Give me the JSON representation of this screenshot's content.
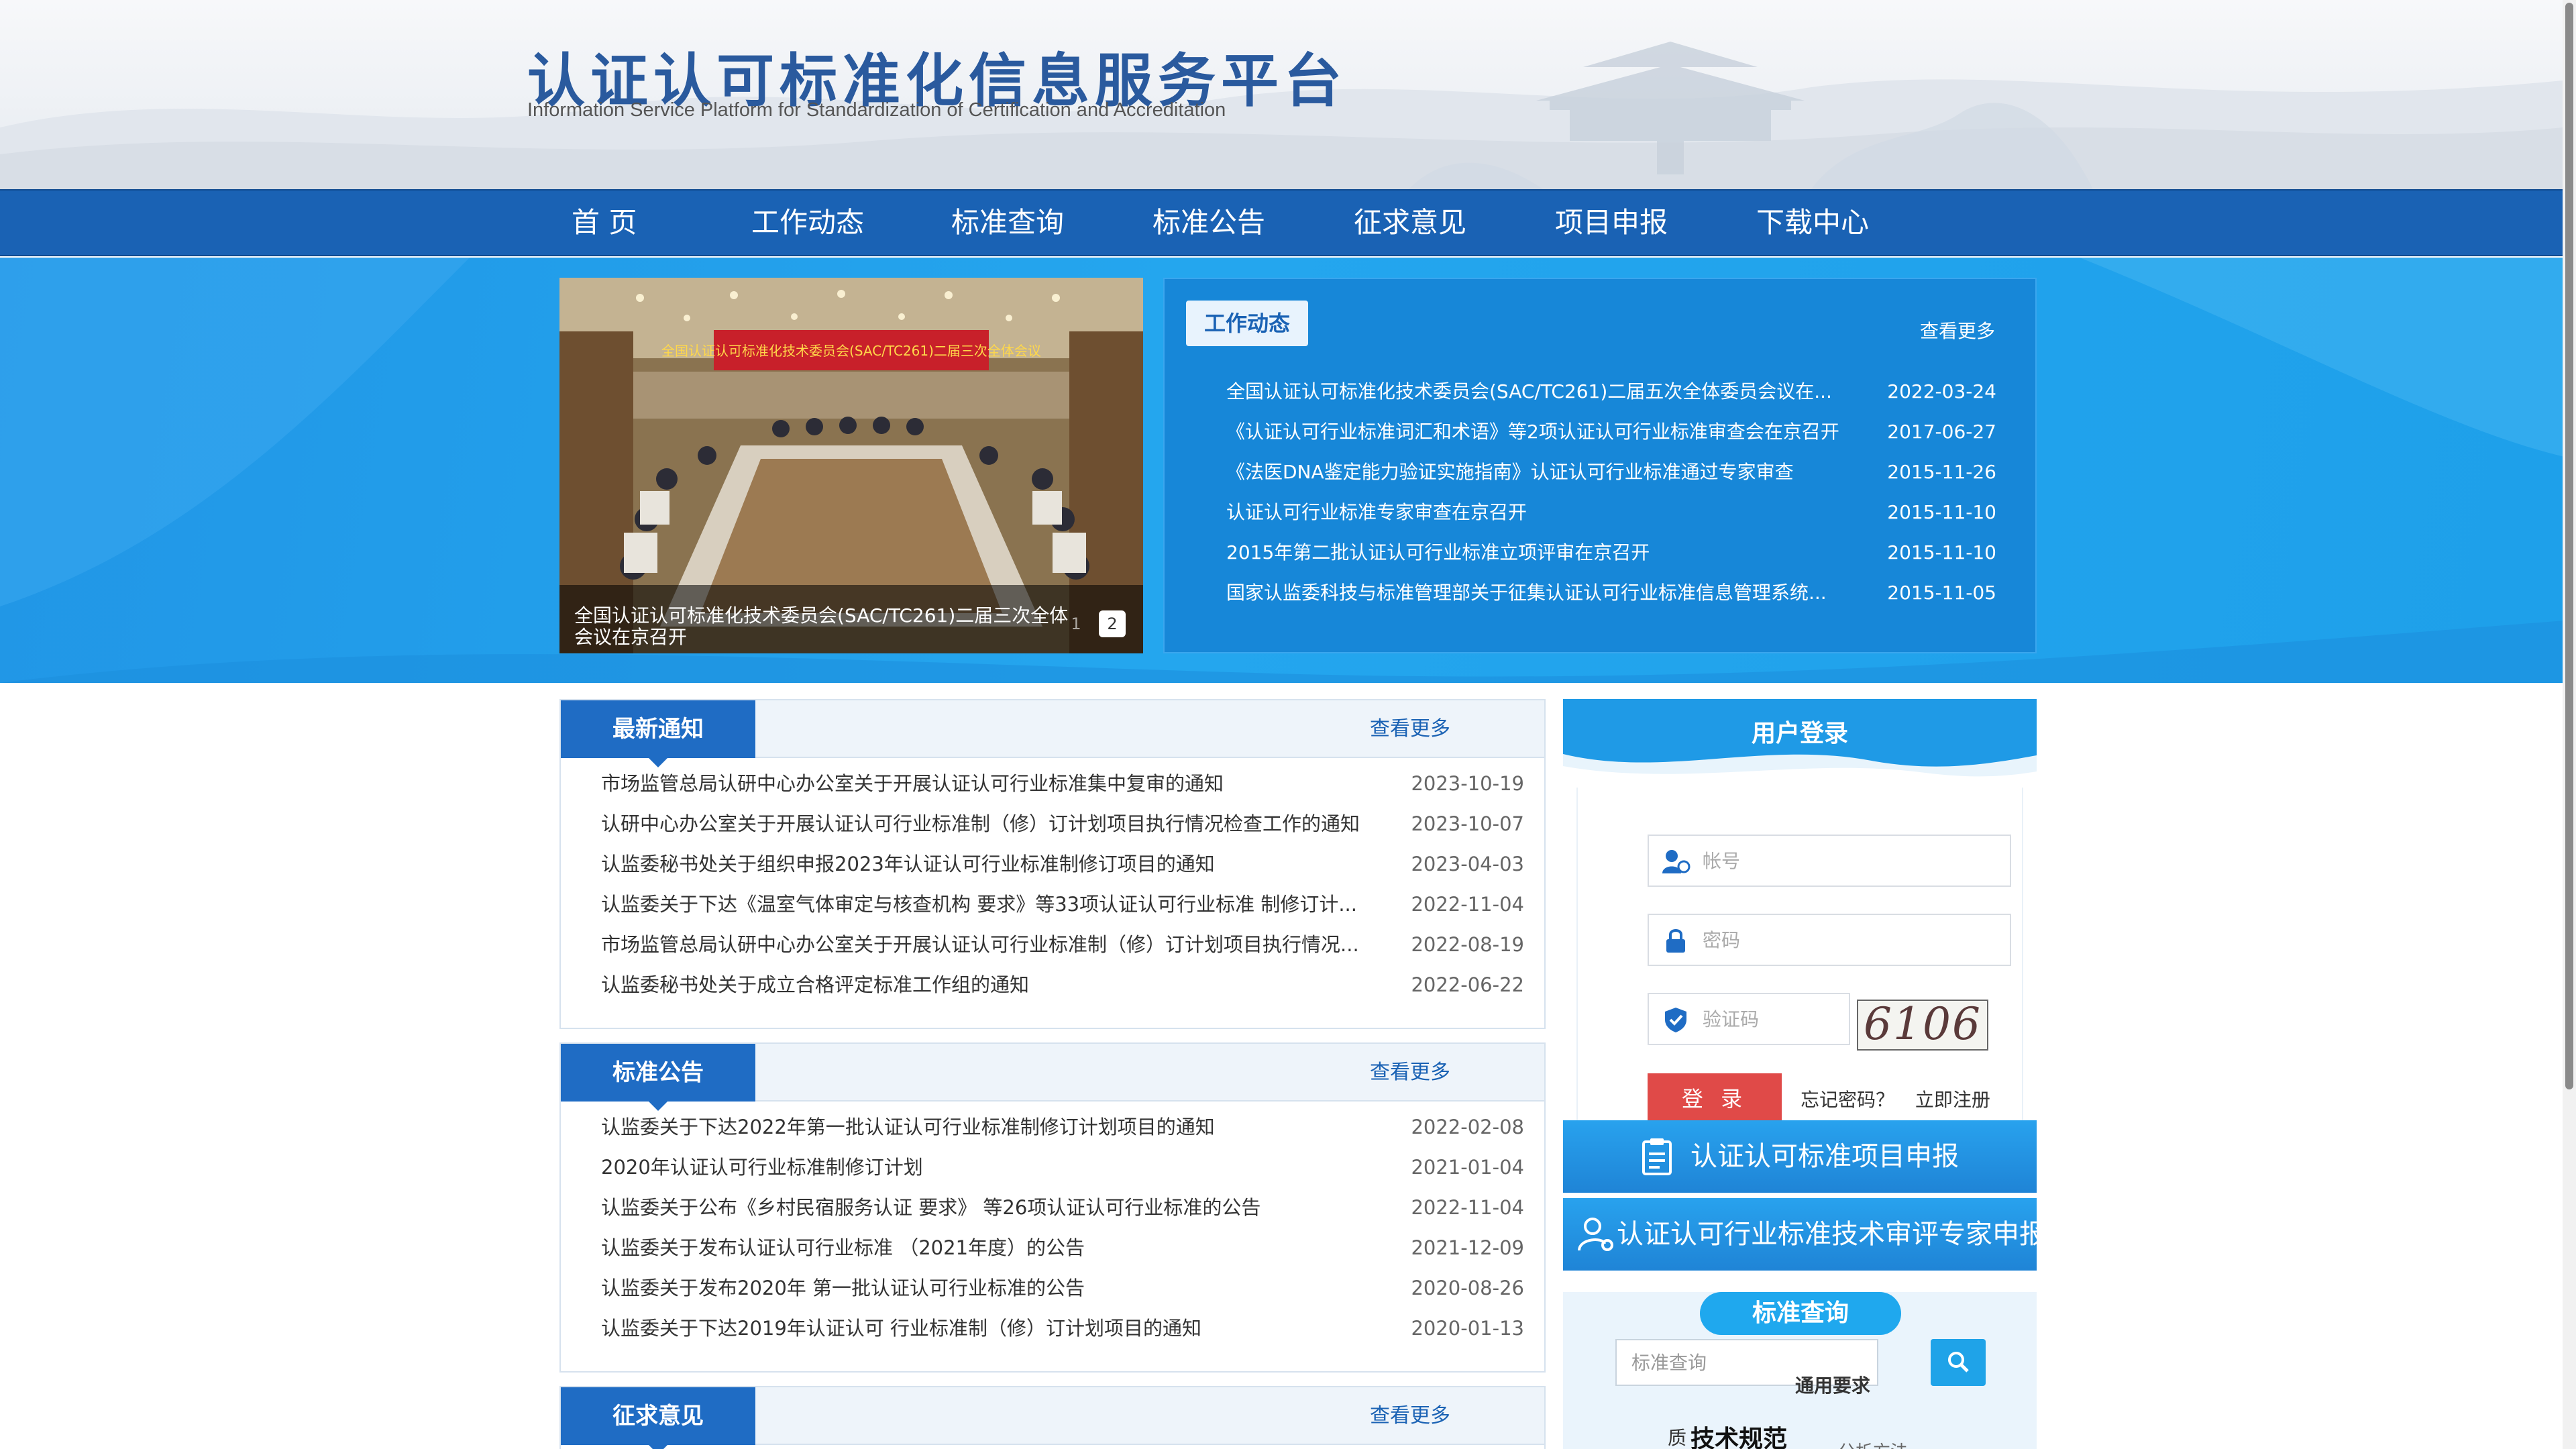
{
  "header": {
    "title": "认证认可标准化信息服务平台",
    "subtitle": "Information Service Platform for Standardization of Certification and Accreditation"
  },
  "nav": {
    "items": [
      "首 页",
      "工作动态",
      "标准查询",
      "标准公告",
      "征求意见",
      "项目申报",
      "下载中心"
    ]
  },
  "slideshow": {
    "banner_text": "全国认证认可标准化技术委员会(SAC/TC261)二届三次全体会议",
    "caption": "全国认证认可标准化技术委员会(SAC/TC261)二届三次全体会议在京召开",
    "dot1": "1",
    "dot2": "2"
  },
  "work": {
    "tab": "工作动态",
    "more": "查看更多",
    "items": [
      {
        "title": "全国认证认可标准化技术委员会(SAC/TC261)二届五次全体委员会议在...",
        "date": "2022-03-24"
      },
      {
        "title": "《认证认可行业标准词汇和术语》等2项认证认可行业标准审查会在京召开",
        "date": "2017-06-27"
      },
      {
        "title": "《法医DNA鉴定能力验证实施指南》认证认可行业标准通过专家审查",
        "date": "2015-11-26"
      },
      {
        "title": "认证认可行业标准专家审查在京召开",
        "date": "2015-11-10"
      },
      {
        "title": "2015年第二批认证认可行业标准立项评审在京召开",
        "date": "2015-11-10"
      },
      {
        "title": "国家认监委科技与标准管理部关于征集认证认可行业标准信息管理系统...",
        "date": "2015-11-05"
      }
    ]
  },
  "notices": {
    "tab": "最新通知",
    "more": "查看更多",
    "items": [
      {
        "title": "市场监管总局认研中心办公室关于开展认证认可行业标准集中复审的通知",
        "date": "2023-10-19"
      },
      {
        "title": "认研中心办公室关于开展认证认可行业标准制（修）订计划项目执行情况检查工作的通知",
        "date": "2023-10-07"
      },
      {
        "title": "认监委秘书处关于组织申报2023年认证认可行业标准制修订项目的通知",
        "date": "2023-04-03"
      },
      {
        "title": "认监委关于下达《温室气体审定与核查机构 要求》等33项认证认可行业标准 制修订计...",
        "date": "2022-11-04"
      },
      {
        "title": "市场监管总局认研中心办公室关于开展认证认可行业标准制（修）订计划项目执行情况...",
        "date": "2022-08-19"
      },
      {
        "title": "认监委秘书处关于成立合格评定标准工作组的通知",
        "date": "2022-06-22"
      }
    ]
  },
  "announcements": {
    "tab": "标准公告",
    "more": "查看更多",
    "items": [
      {
        "title": "认监委关于下达2022年第一批认证认可行业标准制修订计划项目的通知",
        "date": "2022-02-08"
      },
      {
        "title": "2020年认证认可行业标准制修订计划",
        "date": "2021-01-04"
      },
      {
        "title": "认监委关于公布《乡村民宿服务认证 要求》 等26项认证认可行业标准的公告",
        "date": "2022-11-04"
      },
      {
        "title": "认监委关于发布认证认可行业标准 （2021年度）的公告",
        "date": "2021-12-09"
      },
      {
        "title": "认监委关于发布2020年 第一批认证认可行业标准的公告",
        "date": "2020-08-26"
      },
      {
        "title": "认监委关于下达2019年认证认可 行业标准制（修）订计划项目的通知",
        "date": "2020-01-13"
      }
    ]
  },
  "consultation": {
    "tab": "征求意见",
    "more": "查看更多"
  },
  "login": {
    "title": "用户登录",
    "username_placeholder": "帐号",
    "password_placeholder": "密码",
    "code_placeholder": "验证码",
    "captcha": "6106",
    "button": "登 录",
    "forgot": "忘记密码？",
    "register": "立即注册"
  },
  "quick": {
    "project": "认证认可标准项目申报",
    "expert": "认证认可行业标准技术审评专家申报"
  },
  "search": {
    "title": "标准查询",
    "placeholder": "标准查询",
    "keywords": [
      "通用要求",
      "质",
      "技术规范",
      "分析方法"
    ]
  },
  "colors": {
    "nav": "#1a62b4",
    "hero": "#24a6ee",
    "accent": "#1f6cc4",
    "login_button": "#e04a48"
  }
}
